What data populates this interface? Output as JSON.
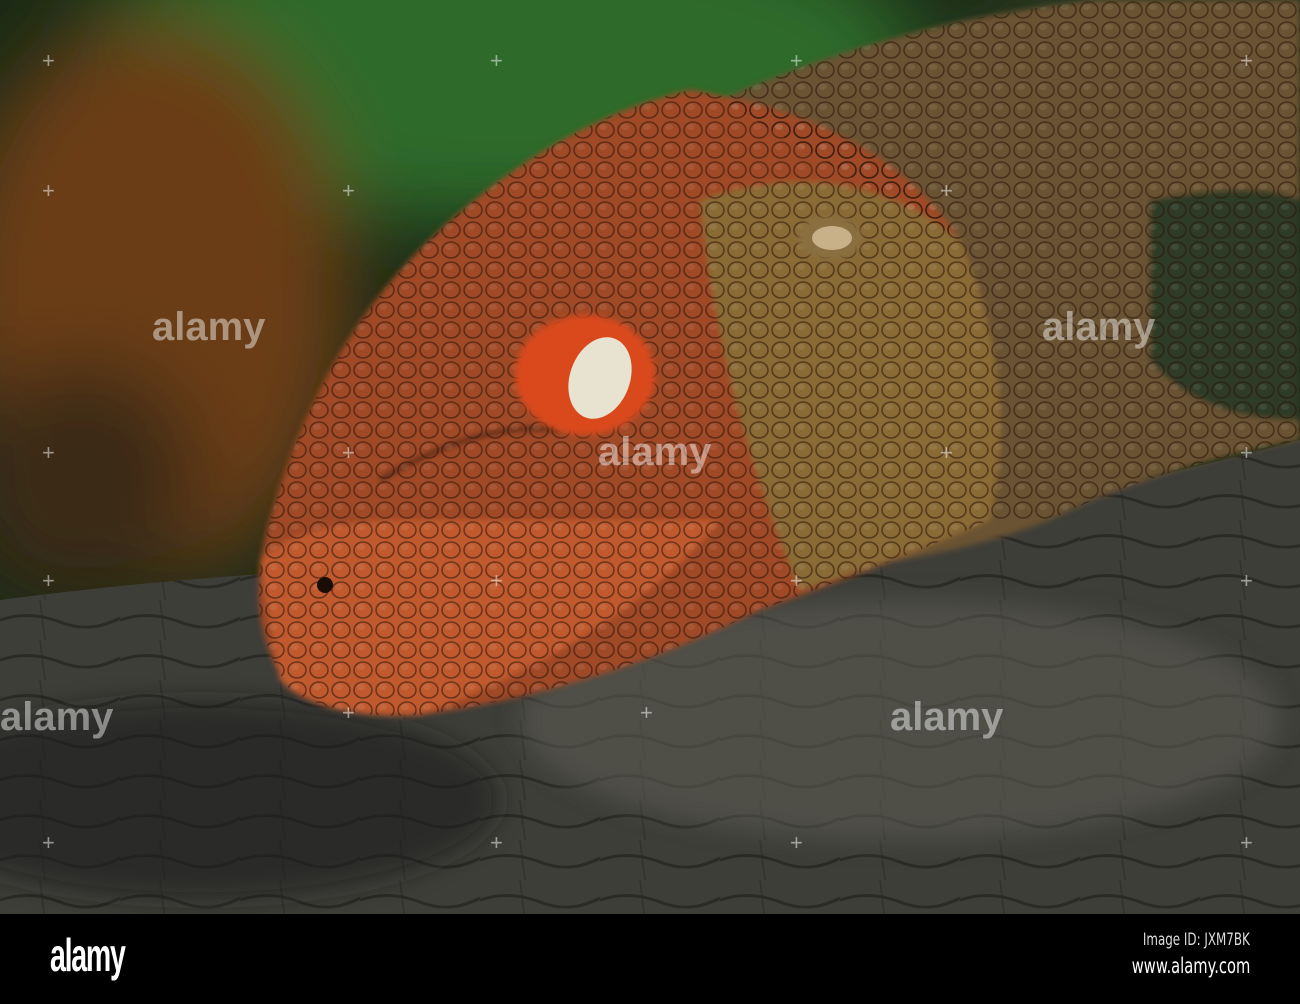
{
  "photo": {
    "subject": "caiman lizard head resting on log",
    "colors": {
      "background_green": "#2f6a2a",
      "background_brown": "#6b3d14",
      "skin_orange": "#b5532a",
      "skin_olive": "#7a5a30",
      "log_grey": "#4a4a44"
    }
  },
  "watermark": {
    "text": "alamy"
  },
  "footer": {
    "logo": "alamy",
    "image_id": "Image ID: JXM7BK",
    "url": "www.alamy.com"
  }
}
